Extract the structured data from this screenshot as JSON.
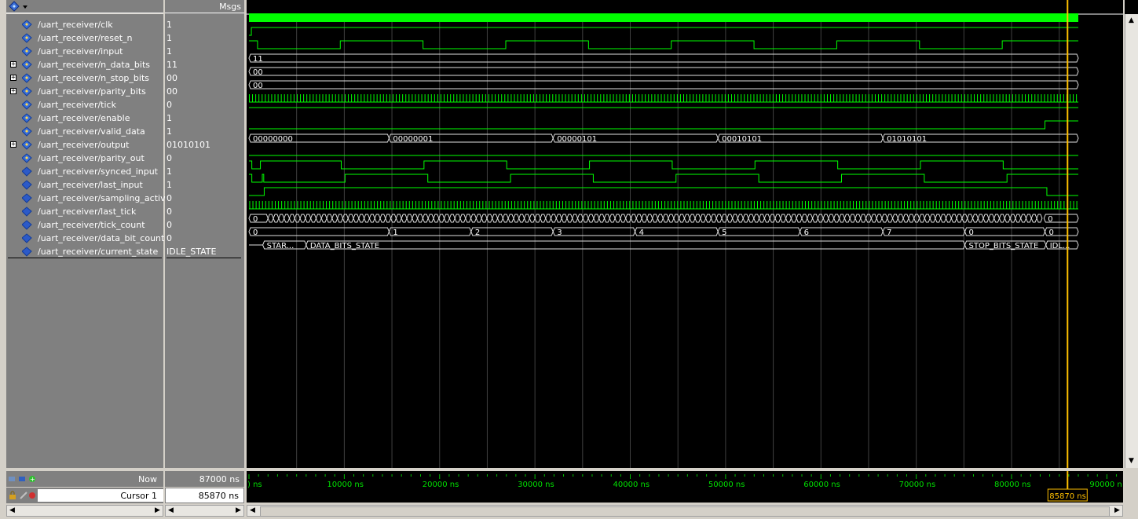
{
  "header": {
    "msgs_label": "Msgs"
  },
  "signals": [
    {
      "name": "/uart_receiver/clk",
      "value": "1",
      "expand": false,
      "icon": "bit-signal-icon"
    },
    {
      "name": "/uart_receiver/reset_n",
      "value": "1",
      "expand": false,
      "icon": "bit-signal-icon"
    },
    {
      "name": "/uart_receiver/input",
      "value": "1",
      "expand": false,
      "icon": "bit-signal-icon"
    },
    {
      "name": "/uart_receiver/n_data_bits",
      "value": "11",
      "expand": true,
      "icon": "bus-signal-icon"
    },
    {
      "name": "/uart_receiver/n_stop_bits",
      "value": "00",
      "expand": true,
      "icon": "bus-signal-icon"
    },
    {
      "name": "/uart_receiver/parity_bits",
      "value": "00",
      "expand": true,
      "icon": "bus-signal-icon"
    },
    {
      "name": "/uart_receiver/tick",
      "value": "0",
      "expand": false,
      "icon": "bit-signal-icon"
    },
    {
      "name": "/uart_receiver/enable",
      "value": "1",
      "expand": false,
      "icon": "bit-signal-icon"
    },
    {
      "name": "/uart_receiver/valid_data",
      "value": "1",
      "expand": false,
      "icon": "bit-signal-icon"
    },
    {
      "name": "/uart_receiver/output",
      "value": "01010101",
      "expand": true,
      "icon": "bus-signal-icon"
    },
    {
      "name": "/uart_receiver/parity_out",
      "value": "0",
      "expand": false,
      "icon": "bit-signal-icon"
    },
    {
      "name": "/uart_receiver/synced_input",
      "value": "1",
      "expand": false,
      "icon": "internal-signal-icon"
    },
    {
      "name": "/uart_receiver/last_input",
      "value": "1",
      "expand": false,
      "icon": "internal-signal-icon"
    },
    {
      "name": "/uart_receiver/sampling_active",
      "value": "0",
      "expand": false,
      "icon": "internal-signal-icon"
    },
    {
      "name": "/uart_receiver/last_tick",
      "value": "0",
      "expand": false,
      "icon": "internal-signal-icon"
    },
    {
      "name": "/uart_receiver/tick_count",
      "value": "0",
      "expand": false,
      "icon": "internal-signal-icon"
    },
    {
      "name": "/uart_receiver/data_bit_count",
      "value": "0",
      "expand": false,
      "icon": "internal-signal-icon"
    },
    {
      "name": "/uart_receiver/current_state",
      "value": "IDLE_STATE",
      "expand": false,
      "icon": "internal-signal-icon"
    }
  ],
  "waves": {
    "n_data_bits": [
      "11"
    ],
    "n_stop_bits": [
      "00"
    ],
    "parity_bits": [
      "00"
    ],
    "output": [
      "00000000",
      "00000001",
      "00000101",
      "00010101",
      "01010101"
    ],
    "tick_count_start": "0",
    "tick_count_end": "0",
    "data_bit_count": [
      "0",
      "1",
      "2",
      "3",
      "4",
      "5",
      "6",
      "7",
      "0",
      "0"
    ],
    "current_state": [
      "STAR...",
      "DATA_BITS_STATE",
      "STOP_BITS_STATE",
      "IDL..."
    ]
  },
  "footer": {
    "now_label": "Now",
    "now_value": "87000 ns",
    "cursor_label": "Cursor 1",
    "cursor_value": "85870 ns",
    "cursor_flag": "85870 ns"
  },
  "timeline": {
    "start_label": ") ns",
    "ticks": [
      "10000 ns",
      "20000 ns",
      "30000 ns",
      "40000 ns",
      "50000 ns",
      "60000 ns",
      "70000 ns",
      "80000 ns",
      "90000 n"
    ]
  },
  "colors": {
    "wave": "#00ff00",
    "wave_dim": "#00c000",
    "cursor": "#ffc000",
    "grid": "#404040",
    "bus_text": "#ffffff"
  }
}
